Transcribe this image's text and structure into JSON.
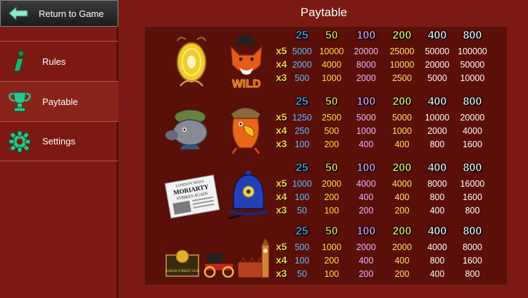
{
  "sidebar": {
    "return_label": "Return to Game",
    "items": [
      {
        "label": "Rules",
        "icon": "info-icon"
      },
      {
        "label": "Paytable",
        "icon": "trophy-icon"
      },
      {
        "label": "Settings",
        "icon": "gear-icon"
      }
    ]
  },
  "title": "Paytable",
  "bets": [
    "25",
    "50",
    "100",
    "200",
    "400",
    "800"
  ],
  "multipliers": [
    "x5",
    "x4",
    "x3"
  ],
  "rows": [
    {
      "symbols": [
        "golden-egg",
        "fox-wild"
      ],
      "wild_label": "WILD",
      "payouts": [
        [
          "5000",
          "10000",
          "20000",
          "25000",
          "50000",
          "100000"
        ],
        [
          "2000",
          "4000",
          "8000",
          "10000",
          "20000",
          "50000"
        ],
        [
          "500",
          "1000",
          "2000",
          "2500",
          "5000",
          "10000"
        ]
      ]
    },
    {
      "symbols": [
        "rat-detective",
        "parrot-detective"
      ],
      "payouts": [
        [
          "1250",
          "2500",
          "5000",
          "5000",
          "10000",
          "20000"
        ],
        [
          "250",
          "500",
          "1000",
          "1000",
          "2000",
          "4000"
        ],
        [
          "100",
          "200",
          "400",
          "400",
          "800",
          "1600"
        ]
      ]
    },
    {
      "symbols": [
        "newspaper",
        "police-helmet"
      ],
      "newspaper_text": [
        "LONDON NEWS",
        "MORIARTY",
        "STRIKES AGAIN"
      ],
      "payouts": [
        [
          "1000",
          "2000",
          "4000",
          "4000",
          "8000",
          "16000"
        ],
        [
          "100",
          "200",
          "400",
          "400",
          "800",
          "1600"
        ],
        [
          "50",
          "100",
          "200",
          "200",
          "400",
          "800"
        ]
      ]
    },
    {
      "symbols": [
        "baker-street-plaque",
        "vintage-car",
        "big-ben"
      ],
      "plaque_text": "BAKER STREET 221B",
      "payouts": [
        [
          "500",
          "1000",
          "2000",
          "2000",
          "4000",
          "8000"
        ],
        [
          "100",
          "200",
          "400",
          "400",
          "800",
          "1600"
        ],
        [
          "50",
          "100",
          "200",
          "200",
          "400",
          "800"
        ]
      ]
    }
  ]
}
